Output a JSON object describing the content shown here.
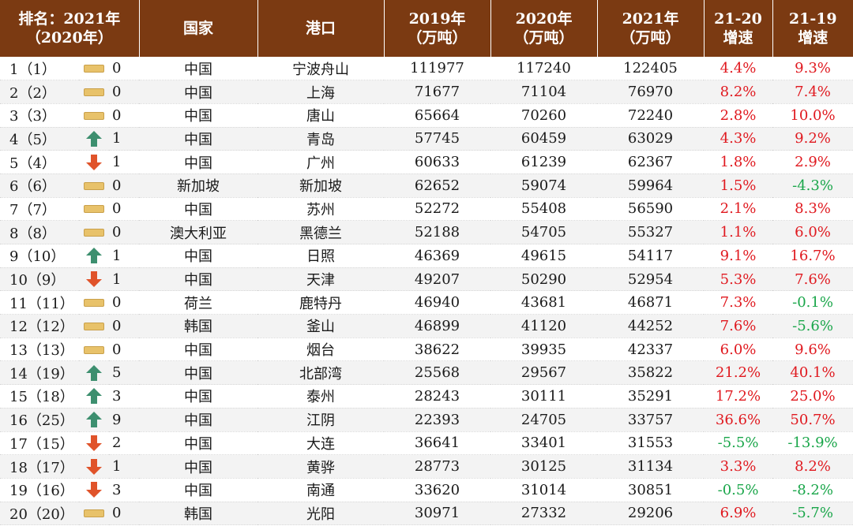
{
  "header": {
    "rank_line1": "排名：2021年",
    "rank_line2": "（2020年）",
    "country": "国家",
    "port": "港口",
    "y2019_line1": "2019年",
    "y2019_line2": "（万吨）",
    "y2020_line1": "2020年",
    "y2020_line2": "（万吨）",
    "y2021_line1": "2021年",
    "y2021_line2": "（万吨）",
    "g2120_line1": "21-20",
    "g2120_line2": "增速",
    "g2119_line1": "21-19",
    "g2119_line2": "增速"
  },
  "colors": {
    "header_bg": "#7b3a12",
    "up": "#3d8f6f",
    "down": "#e0532a",
    "flat": "#e8c26a",
    "positive": "#e0191f",
    "negative": "#1aa64a"
  },
  "rows": [
    {
      "rank": "1（1）",
      "trend": "flat",
      "change": "0",
      "country": "中国",
      "port": "宁波舟山",
      "y2019": "111977",
      "y2020": "117240",
      "y2021": "122405",
      "g2120": "4.4%",
      "g2119": "9.3%"
    },
    {
      "rank": "2（2）",
      "trend": "flat",
      "change": "0",
      "country": "中国",
      "port": "上海",
      "y2019": "71677",
      "y2020": "71104",
      "y2021": "76970",
      "g2120": "8.2%",
      "g2119": "7.4%"
    },
    {
      "rank": "3（3）",
      "trend": "flat",
      "change": "0",
      "country": "中国",
      "port": "唐山",
      "y2019": "65664",
      "y2020": "70260",
      "y2021": "72240",
      "g2120": "2.8%",
      "g2119": "10.0%"
    },
    {
      "rank": "4（5）",
      "trend": "up",
      "change": "1",
      "country": "中国",
      "port": "青岛",
      "y2019": "57745",
      "y2020": "60459",
      "y2021": "63029",
      "g2120": "4.3%",
      "g2119": "9.2%"
    },
    {
      "rank": "5（4）",
      "trend": "down",
      "change": "1",
      "country": "中国",
      "port": "广州",
      "y2019": "60633",
      "y2020": "61239",
      "y2021": "62367",
      "g2120": "1.8%",
      "g2119": "2.9%"
    },
    {
      "rank": "6（6）",
      "trend": "flat",
      "change": "0",
      "country": "新加坡",
      "port": "新加坡",
      "y2019": "62652",
      "y2020": "59074",
      "y2021": "59964",
      "g2120": "1.5%",
      "g2119": "-4.3%"
    },
    {
      "rank": "7（7）",
      "trend": "flat",
      "change": "0",
      "country": "中国",
      "port": "苏州",
      "y2019": "52272",
      "y2020": "55408",
      "y2021": "56590",
      "g2120": "2.1%",
      "g2119": "8.3%"
    },
    {
      "rank": "8（8）",
      "trend": "flat",
      "change": "0",
      "country": "澳大利亚",
      "port": "黑德兰",
      "y2019": "52188",
      "y2020": "54705",
      "y2021": "55327",
      "g2120": "1.1%",
      "g2119": "6.0%"
    },
    {
      "rank": "9（10）",
      "trend": "up",
      "change": "1",
      "country": "中国",
      "port": "日照",
      "y2019": "46369",
      "y2020": "49615",
      "y2021": "54117",
      "g2120": "9.1%",
      "g2119": "16.7%"
    },
    {
      "rank": "10（9）",
      "trend": "down",
      "change": "1",
      "country": "中国",
      "port": "天津",
      "y2019": "49207",
      "y2020": "50290",
      "y2021": "52954",
      "g2120": "5.3%",
      "g2119": "7.6%"
    },
    {
      "rank": "11（11）",
      "trend": "flat",
      "change": "0",
      "country": "荷兰",
      "port": "鹿特丹",
      "y2019": "46940",
      "y2020": "43681",
      "y2021": "46871",
      "g2120": "7.3%",
      "g2119": "-0.1%"
    },
    {
      "rank": "12（12）",
      "trend": "flat",
      "change": "0",
      "country": "韩国",
      "port": "釜山",
      "y2019": "46899",
      "y2020": "41120",
      "y2021": "44252",
      "g2120": "7.6%",
      "g2119": "-5.6%"
    },
    {
      "rank": "13（13）",
      "trend": "flat",
      "change": "0",
      "country": "中国",
      "port": "烟台",
      "y2019": "38622",
      "y2020": "39935",
      "y2021": "42337",
      "g2120": "6.0%",
      "g2119": "9.6%"
    },
    {
      "rank": "14（19）",
      "trend": "up",
      "change": "5",
      "country": "中国",
      "port": "北部湾",
      "y2019": "25568",
      "y2020": "29567",
      "y2021": "35822",
      "g2120": "21.2%",
      "g2119": "40.1%"
    },
    {
      "rank": "15（18）",
      "trend": "up",
      "change": "3",
      "country": "中国",
      "port": "泰州",
      "y2019": "28243",
      "y2020": "30111",
      "y2021": "35291",
      "g2120": "17.2%",
      "g2119": "25.0%"
    },
    {
      "rank": "16（25）",
      "trend": "up",
      "change": "9",
      "country": "中国",
      "port": "江阴",
      "y2019": "22393",
      "y2020": "24705",
      "y2021": "33757",
      "g2120": "36.6%",
      "g2119": "50.7%"
    },
    {
      "rank": "17（15）",
      "trend": "down",
      "change": "2",
      "country": "中国",
      "port": "大连",
      "y2019": "36641",
      "y2020": "33401",
      "y2021": "31553",
      "g2120": "-5.5%",
      "g2119": "-13.9%"
    },
    {
      "rank": "18（17）",
      "trend": "down",
      "change": "1",
      "country": "中国",
      "port": "黄骅",
      "y2019": "28773",
      "y2020": "30125",
      "y2021": "31134",
      "g2120": "3.3%",
      "g2119": "8.2%"
    },
    {
      "rank": "19（16）",
      "trend": "down",
      "change": "3",
      "country": "中国",
      "port": "南通",
      "y2019": "33620",
      "y2020": "31014",
      "y2021": "30851",
      "g2120": "-0.5%",
      "g2119": "-8.2%"
    },
    {
      "rank": "20（20）",
      "trend": "flat",
      "change": "0",
      "country": "韩国",
      "port": "光阳",
      "y2019": "30971",
      "y2020": "27332",
      "y2021": "29206",
      "g2120": "6.9%",
      "g2119": "-5.7%"
    }
  ]
}
